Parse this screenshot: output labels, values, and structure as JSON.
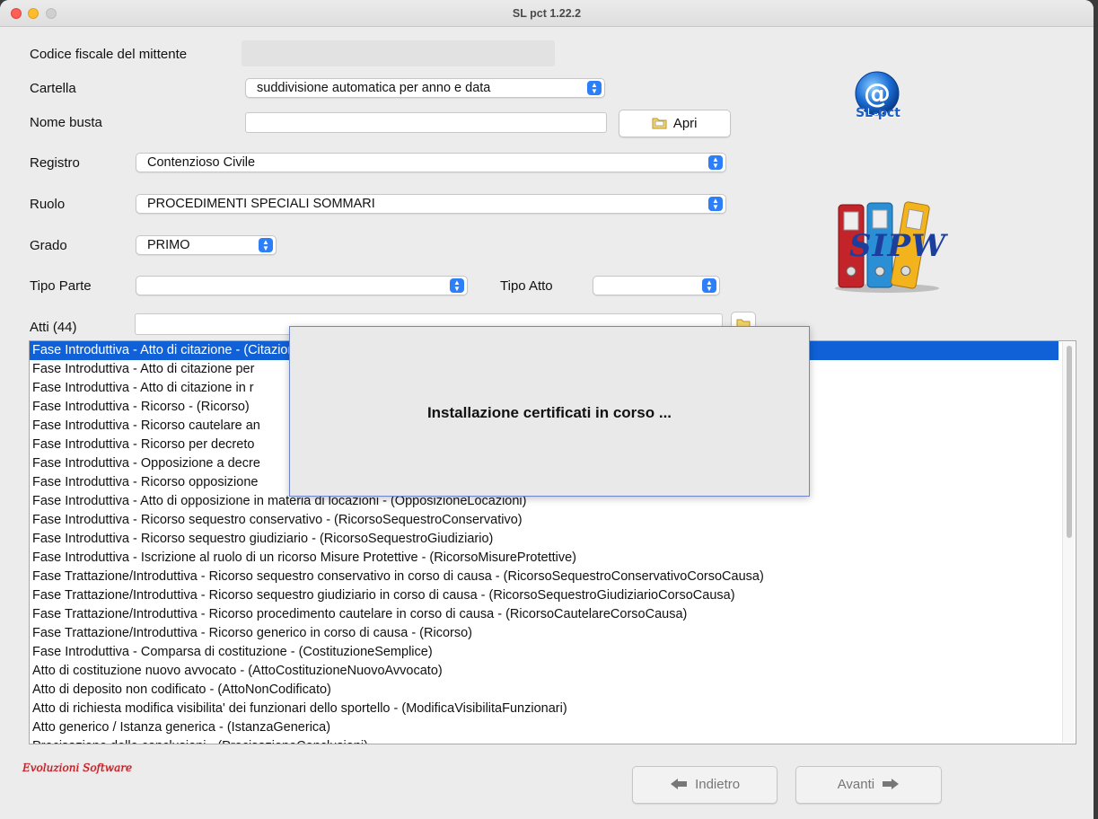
{
  "window": {
    "title": "SL pct 1.22.2"
  },
  "form": {
    "codice_fiscale_label": "Codice fiscale del mittente",
    "codice_fiscale_value": "",
    "cartella_label": "Cartella",
    "cartella_value": "suddivisione automatica per anno e data",
    "nome_busta_label": "Nome busta",
    "nome_busta_value": "",
    "apri_label": "Apri",
    "registro_label": "Registro",
    "registro_value": "Contenzioso Civile",
    "ruolo_label": "Ruolo",
    "ruolo_value": "PROCEDIMENTI SPECIALI SOMMARI",
    "grado_label": "Grado",
    "grado_value": "PRIMO",
    "tipo_parte_label": "Tipo Parte",
    "tipo_parte_value": "",
    "tipo_atto_label": "Tipo Atto",
    "tipo_atto_value": "",
    "atti_label": "Atti (44)",
    "atti_filter_value": ""
  },
  "logos": {
    "slpct_text": "SL-pct",
    "sipw_text": "SIPW"
  },
  "atti_list": [
    "Fase Introduttiva - Atto di citazione - (Citazione)",
    "Fase Introduttiva - Atto di citazione per",
    "Fase Introduttiva - Atto di citazione in r",
    "Fase Introduttiva - Ricorso - (Ricorso)",
    "Fase Introduttiva - Ricorso cautelare an",
    "Fase Introduttiva - Ricorso per decreto",
    "Fase Introduttiva - Opposizione a decre",
    "Fase Introduttiva - Ricorso opposizione",
    "Fase Introduttiva - Atto di opposizione in materia di locazioni - (OpposizioneLocazioni)",
    "Fase Introduttiva - Ricorso sequestro conservativo - (RicorsoSequestroConservativo)",
    "Fase Introduttiva - Ricorso sequestro giudiziario - (RicorsoSequestroGiudiziario)",
    "Fase Introduttiva - Iscrizione al ruolo di un ricorso Misure Protettive - (RicorsoMisureProtettive)",
    "Fase Trattazione/Introduttiva - Ricorso sequestro conservativo in corso di causa - (RicorsoSequestroConservativoCorsoCausa)",
    "Fase Trattazione/Introduttiva - Ricorso sequestro giudiziario in corso di causa - (RicorsoSequestroGiudiziarioCorsoCausa)",
    "Fase Trattazione/Introduttiva - Ricorso procedimento cautelare in corso di causa - (RicorsoCautelareCorsoCausa)",
    "Fase Trattazione/Introduttiva - Ricorso generico in corso di causa - (Ricorso)",
    "Fase Introduttiva - Comparsa di costituzione - (CostituzioneSemplice)",
    "Atto di costituzione nuovo avvocato - (AttoCostituzioneNuovoAvvocato)",
    "Atto di deposito non codificato - (AttoNonCodificato)",
    "Atto di richiesta modifica visibilita' dei funzionari dello sportello - (ModificaVisibilitaFunzionari)",
    "Atto generico / Istanza generica - (IstanzaGenerica)",
    "Precisazione delle conclusioni - (PrecisazioneConclusioni)"
  ],
  "dialog": {
    "message": "Installazione certificati in corso ..."
  },
  "footer": {
    "brand": "Evoluzioni Software",
    "back_label": "Indietro",
    "next_label": "Avanti"
  }
}
